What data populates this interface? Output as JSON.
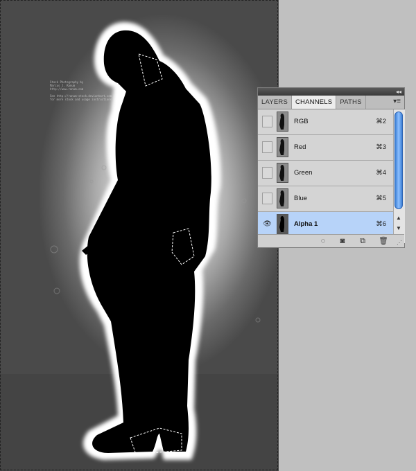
{
  "canvas": {
    "watermark_text": "Stock Photography by\nMarcus J. Ranum\nhttp://www.ranum.com\n\nSee http://ranum-stock.deviantart.com\nfor more stock and usage instructions"
  },
  "panel": {
    "tabs": [
      {
        "label": "LAYERS",
        "active": false
      },
      {
        "label": "CHANNELS",
        "active": true
      },
      {
        "label": "PATHS",
        "active": false
      }
    ],
    "channels": [
      {
        "name": "RGB",
        "shortcut": "⌘2",
        "visible": false,
        "selected": false
      },
      {
        "name": "Red",
        "shortcut": "⌘3",
        "visible": false,
        "selected": false
      },
      {
        "name": "Green",
        "shortcut": "⌘4",
        "visible": false,
        "selected": false
      },
      {
        "name": "Blue",
        "shortcut": "⌘5",
        "visible": false,
        "selected": false
      },
      {
        "name": "Alpha 1",
        "shortcut": "⌘6",
        "visible": true,
        "selected": true
      }
    ],
    "eye_glyph": "👁",
    "icons": {
      "collapse": "◂◂",
      "menu": "▾≡",
      "scroll_up": "▲",
      "scroll_down": "▼",
      "load_selection": "◌",
      "save_selection": "◙",
      "new_channel": "⧉",
      "delete": "🗑",
      "grip": "⋰"
    }
  },
  "colors": {
    "selected_row": "#b7d3f9",
    "scroll_accent": "#3c7fd6",
    "workspace": "#c0c0c0"
  }
}
